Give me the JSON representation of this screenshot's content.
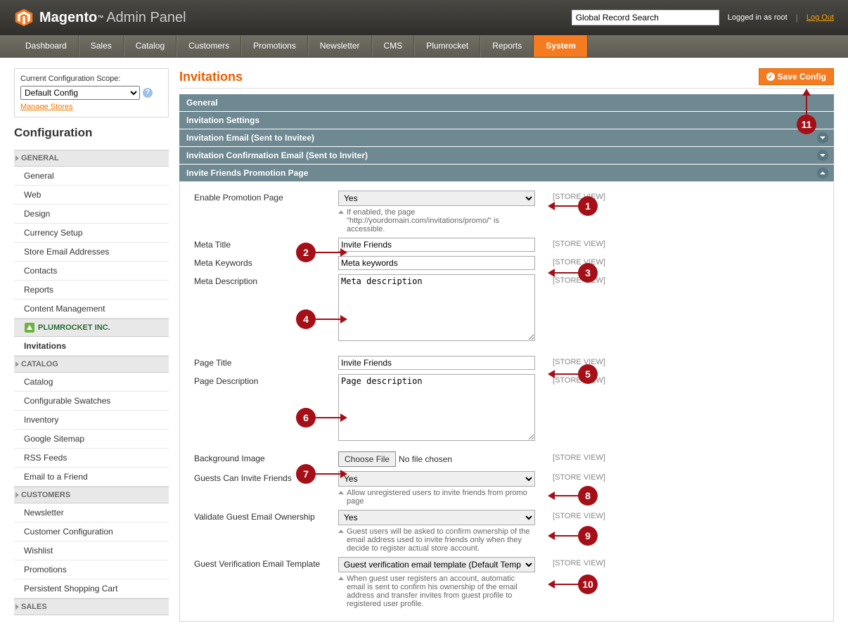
{
  "header": {
    "brand1": "Magento",
    "brand2": "Admin Panel",
    "search_placeholder": "Global Record Search",
    "logged_in": "Logged in as root",
    "logout": "Log Out"
  },
  "nav": [
    "Dashboard",
    "Sales",
    "Catalog",
    "Customers",
    "Promotions",
    "Newsletter",
    "CMS",
    "Plumrocket",
    "Reports",
    "System"
  ],
  "nav_active": 9,
  "scope": {
    "label": "Current Configuration Scope:",
    "value": "Default Config",
    "manage": "Manage Stores"
  },
  "config_title": "Configuration",
  "sidebar": {
    "general": {
      "head": "GENERAL",
      "items": [
        "General",
        "Web",
        "Design",
        "Currency Setup",
        "Store Email Addresses",
        "Contacts",
        "Reports",
        "Content Management"
      ]
    },
    "plumrocket": {
      "head": "PLUMROCKET INC.",
      "items": [
        "Invitations"
      ]
    },
    "catalog": {
      "head": "CATALOG",
      "items": [
        "Catalog",
        "Configurable Swatches",
        "Inventory",
        "Google Sitemap",
        "RSS Feeds",
        "Email to a Friend"
      ]
    },
    "customers": {
      "head": "CUSTOMERS",
      "items": [
        "Newsletter",
        "Customer Configuration",
        "Wishlist",
        "Promotions",
        "Persistent Shopping Cart"
      ]
    },
    "sales": {
      "head": "SALES",
      "items": []
    }
  },
  "page": {
    "title": "Invitations",
    "save": "Save Config"
  },
  "fieldsets": [
    {
      "label": "General",
      "open": false
    },
    {
      "label": "Invitation Settings",
      "open": false
    },
    {
      "label": "Invitation Email (Sent to Invitee)",
      "open": false,
      "toggle": true
    },
    {
      "label": "Invitation Confirmation Email (Sent to Inviter)",
      "open": false,
      "toggle": true
    },
    {
      "label": "Invite Friends Promotion Page",
      "open": true,
      "toggle": true
    }
  ],
  "scope_text": "[STORE VIEW]",
  "form": {
    "enable": {
      "label": "Enable Promotion Page",
      "value": "Yes",
      "hint": "If enabled, the page \"http://yourdomain.com/invitations/promo/\" is accessible."
    },
    "meta_title": {
      "label": "Meta Title",
      "value": "Invite Friends"
    },
    "meta_keywords": {
      "label": "Meta Keywords",
      "value": "Meta keywords"
    },
    "meta_desc": {
      "label": "Meta Description",
      "value": "Meta description"
    },
    "page_title": {
      "label": "Page Title",
      "value": "Invite Friends"
    },
    "page_desc": {
      "label": "Page Description",
      "value": "Page description"
    },
    "bg": {
      "label": "Background Image",
      "button": "Choose File",
      "status": "No file chosen"
    },
    "guests_invite": {
      "label": "Guests Can Invite Friends",
      "value": "Yes",
      "hint": "Allow unregistered users to invite friends from promo page"
    },
    "validate": {
      "label": "Validate Guest Email Ownership",
      "value": "Yes",
      "hint": "Guest users will be asked to confirm ownership of the email address used to invite friends only when they decide to register actual store account."
    },
    "template": {
      "label": "Guest Verification Email Template",
      "value": "Guest verification email template (Default Template)",
      "hint": "When guest user registers an account, automatic email is sent to confirm his ownership of the email address and transfer invites from guest profile to registered user profile."
    }
  },
  "callouts": [
    "1",
    "2",
    "3",
    "4",
    "5",
    "6",
    "7",
    "8",
    "9",
    "10",
    "11"
  ]
}
